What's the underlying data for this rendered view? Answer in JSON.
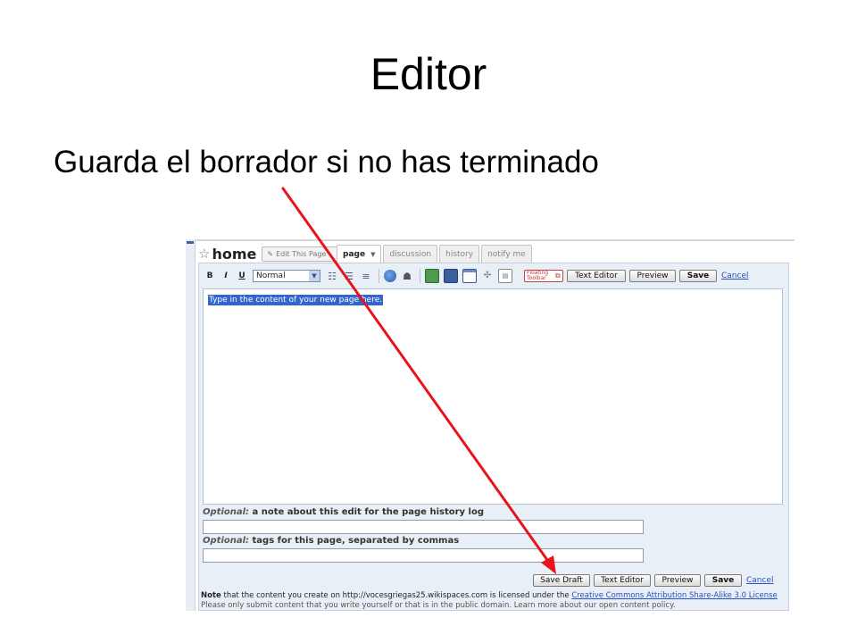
{
  "slide": {
    "title": "Editor",
    "bullet": "Guarda el borrador si no has terminado"
  },
  "wiki": {
    "page_title": "home",
    "edit_this_page": "Edit This Page",
    "tabs": [
      {
        "label": "page",
        "active": true
      },
      {
        "label": "discussion",
        "active": false
      },
      {
        "label": "history",
        "active": false
      },
      {
        "label": "notify me",
        "active": false
      }
    ],
    "toolbar": {
      "bold": "B",
      "italic": "I",
      "underline": "U",
      "format_selected": "Normal",
      "floating_toolbar": "Floating Toolbar",
      "text_editor": "Text Editor",
      "preview": "Preview",
      "save": "Save",
      "cancel": "Cancel"
    },
    "content_placeholder": "Type in the content of your new page here.",
    "note_label_optional": "Optional:",
    "note_label_rest": " a note about this edit for the page history log",
    "tags_label_optional": "Optional:",
    "tags_label_rest": " tags for this page, separated by commas",
    "bottom": {
      "save_draft": "Save Draft",
      "text_editor": "Text Editor",
      "preview": "Preview",
      "save": "Save",
      "cancel": "Cancel"
    },
    "notice": {
      "note_bold": "Note",
      "text": " that the content you create on http://vocesgriegas25.wikispaces.com is licensed under the ",
      "license": "Creative Commons Attribution Share-Alike 3.0 License",
      "line2": "Please only submit content that you write yourself or that is in the public domain. Learn more about our open content policy."
    }
  },
  "colors": {
    "arrow": "#e8141c",
    "selection": "#3366cc",
    "panel": "#e9eff7"
  }
}
